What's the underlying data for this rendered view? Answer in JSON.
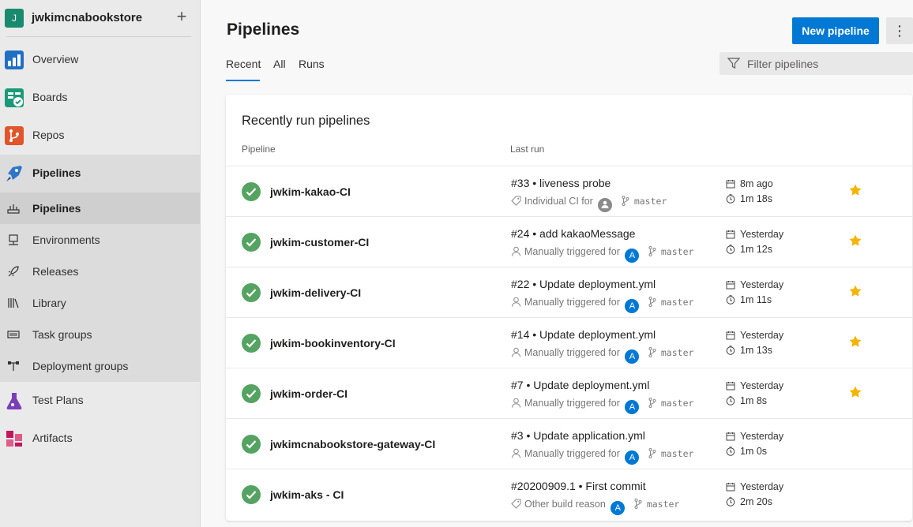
{
  "org": {
    "initial": "J",
    "name": "jwkimcnabookstore",
    "add_icon": "plus-icon"
  },
  "nav": {
    "overview": "Overview",
    "boards": "Boards",
    "repos": "Repos",
    "pipelines": "Pipelines",
    "sub": {
      "pipelines": "Pipelines",
      "environments": "Environments",
      "releases": "Releases",
      "library": "Library",
      "task_groups": "Task groups",
      "deployment_groups": "Deployment groups"
    },
    "test_plans": "Test Plans",
    "artifacts": "Artifacts"
  },
  "header": {
    "title": "Pipelines",
    "new_button": "New pipeline",
    "more_icon": "more-vertical-icon"
  },
  "tabs": [
    "Recent",
    "All",
    "Runs"
  ],
  "filter": {
    "placeholder": "Filter pipelines"
  },
  "card": {
    "title": "Recently run pipelines",
    "col_pipeline": "Pipeline",
    "col_last_run": "Last run"
  },
  "rows": [
    {
      "name": "jwkim-kakao-CI",
      "run": "#33 • liveness probe",
      "trigger": "Individual CI for",
      "trigger_icon": "tag-icon",
      "avatar": "",
      "branch": "master",
      "when": "8m ago",
      "duration": "1m 18s",
      "starred": true
    },
    {
      "name": "jwkim-customer-CI",
      "run": "#24 • add kakaoMessage",
      "trigger": "Manually triggered for",
      "trigger_icon": "person-icon",
      "avatar": "A",
      "branch": "master",
      "when": "Yesterday",
      "duration": "1m 12s",
      "starred": true
    },
    {
      "name": "jwkim-delivery-CI",
      "run": "#22 • Update deployment.yml",
      "trigger": "Manually triggered for",
      "trigger_icon": "person-icon",
      "avatar": "A",
      "branch": "master",
      "when": "Yesterday",
      "duration": "1m 11s",
      "starred": true
    },
    {
      "name": "jwkim-bookinventory-CI",
      "run": "#14 • Update deployment.yml",
      "trigger": "Manually triggered for",
      "trigger_icon": "person-icon",
      "avatar": "A",
      "branch": "master",
      "when": "Yesterday",
      "duration": "1m 13s",
      "starred": true
    },
    {
      "name": "jwkim-order-CI",
      "run": "#7 • Update deployment.yml",
      "trigger": "Manually triggered for",
      "trigger_icon": "person-icon",
      "avatar": "A",
      "branch": "master",
      "when": "Yesterday",
      "duration": "1m 8s",
      "starred": true
    },
    {
      "name": "jwkimcnabookstore-gateway-CI",
      "run": "#3 • Update application.yml",
      "trigger": "Manually triggered for",
      "trigger_icon": "person-icon",
      "avatar": "A",
      "branch": "master",
      "when": "Yesterday",
      "duration": "1m 0s",
      "starred": false
    },
    {
      "name": "jwkim-aks - CI",
      "run": "#20200909.1 • First commit",
      "trigger": "Other build reason",
      "trigger_icon": "tag-icon",
      "avatar": "A",
      "branch": "master",
      "when": "Yesterday",
      "duration": "2m 20s",
      "starred": false
    }
  ],
  "colors": {
    "accent": "#0078d4",
    "success": "#55a362",
    "star": "#f5b400"
  }
}
